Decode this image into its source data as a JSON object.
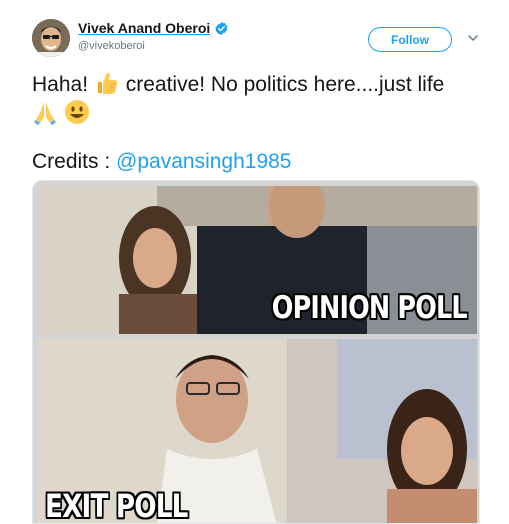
{
  "tweet": {
    "author": {
      "display_name": "Vivek Anand Oberoi",
      "handle": "@vivekoberoi",
      "verified": true
    },
    "follow_label": "Follow",
    "text_line1": "Haha!",
    "text_line1_rest": " creative! No politics here....just life",
    "emojis": [
      "thumbs-up-icon",
      "folded-hands-icon",
      "smiley-icon"
    ],
    "credits_label": "Credits : ",
    "credits_mention": "@pavansingh1985",
    "media": {
      "top_caption": "OPINION POLL",
      "bottom_caption": "EXIT POLL"
    }
  },
  "colors": {
    "accent": "#1da1f2",
    "text": "#14171a",
    "muted": "#657786"
  }
}
